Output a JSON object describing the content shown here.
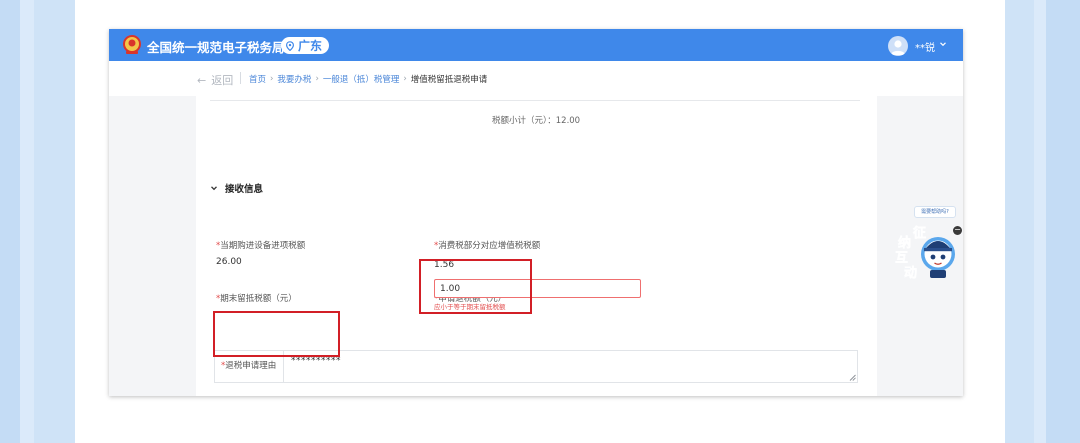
{
  "header": {
    "site_title": "全国统一规范电子税务局",
    "region": "广东",
    "user_name": "**锐",
    "brand_color": "#3f88ea"
  },
  "nav": {
    "back_label": "返回",
    "breadcrumb": [
      {
        "label": "首页",
        "link": true
      },
      {
        "label": "我要办税",
        "link": true
      },
      {
        "label": "一般退（抵）税管理",
        "link": true
      },
      {
        "label": "增值税留抵退税申请",
        "link": false
      }
    ],
    "separator": "›"
  },
  "summary": {
    "subtotal_text": "税额小计（元）：12.00"
  },
  "section": {
    "title": "接收信息"
  },
  "fields": {
    "current_input_tax": {
      "required_mark": "*",
      "label": "当期购进设备进项税额",
      "value": "26.00"
    },
    "consumption_tax": {
      "required_mark": "*",
      "label": "消费税部分对应增值税税额",
      "value": "1.56"
    },
    "end_retained_tax": {
      "required_mark": "*",
      "label": "期末留抵税额（元）"
    },
    "refund_amount": {
      "required_mark": "*",
      "label": "申请退税额（元）",
      "value": "1.00",
      "error": "应小于等于期末留抵税额"
    },
    "refund_reason": {
      "required_mark": "*",
      "label": "退税申请理由",
      "value": "**********"
    }
  },
  "assistant": {
    "bubble_text": "需要帮助吗?",
    "chars": [
      "纳",
      "征",
      "互",
      "动"
    ],
    "close_label": "−"
  },
  "colors": {
    "highlight": "#d21f26",
    "error": "#e24b4b",
    "link": "#4a86d8"
  }
}
